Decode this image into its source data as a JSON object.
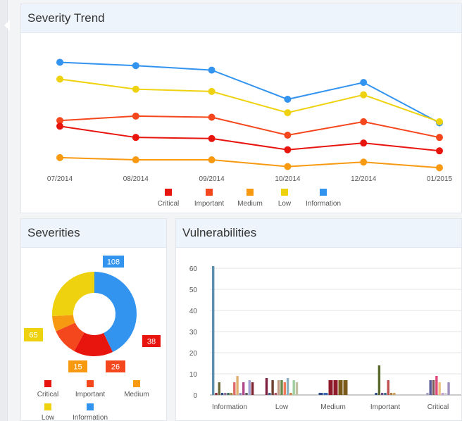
{
  "colors": {
    "critical": "#e8150f",
    "important": "#f5471d",
    "medium": "#f79a12",
    "low": "#efd20f",
    "information": "#3394f0"
  },
  "trend": {
    "title": "Severity Trend",
    "legend": [
      "Critical",
      "Important",
      "Medium",
      "Low",
      "Information"
    ],
    "chart_data": {
      "type": "line",
      "x": [
        "07/2014",
        "08/2014",
        "09/2014",
        "10/2014",
        "12/2014",
        "01/2015"
      ],
      "series": [
        {
          "name": "Information",
          "color": "#3394f0",
          "values": [
            108,
            105,
            101,
            75,
            90,
            54
          ]
        },
        {
          "name": "Low",
          "color": "#efd20f",
          "values": [
            93,
            84,
            82,
            63,
            79,
            55
          ]
        },
        {
          "name": "Important",
          "color": "#f5471d",
          "values": [
            56,
            60,
            59,
            43,
            55,
            41
          ]
        },
        {
          "name": "Critical",
          "color": "#e8150f",
          "values": [
            51,
            41,
            40,
            30,
            36,
            29
          ]
        },
        {
          "name": "Medium",
          "color": "#f79a12",
          "values": [
            23,
            21,
            21,
            15,
            19,
            14
          ]
        }
      ],
      "ylim": [
        0,
        115
      ],
      "legend_position": "bottom"
    }
  },
  "severities": {
    "title": "Severities",
    "legend": [
      "Critical",
      "Important",
      "Medium",
      "Low",
      "Information"
    ],
    "chart_data": {
      "type": "pie",
      "donut": true,
      "labels": [
        "Information",
        "Critical",
        "Important",
        "Medium",
        "Low"
      ],
      "values": [
        108,
        38,
        26,
        15,
        65
      ],
      "colors": [
        "#3394f0",
        "#e8150f",
        "#f5471d",
        "#f79a12",
        "#efd20f"
      ]
    }
  },
  "vulnerabilities": {
    "title": "Vulnerabilities",
    "chart_data": {
      "type": "bar",
      "categories": [
        "Information",
        "Low",
        "Medium",
        "Important",
        "Critical"
      ],
      "ylim": [
        0,
        60
      ],
      "yticks": [
        0,
        10,
        20,
        30,
        40,
        50,
        60
      ],
      "bars": [
        [
          61,
          1,
          6,
          1,
          1,
          1,
          1,
          6,
          9,
          1,
          6,
          1,
          7,
          6
        ],
        [
          8,
          1,
          7,
          1,
          7,
          7,
          6,
          8,
          1,
          7,
          6
        ],
        [
          1,
          1,
          7,
          7,
          7,
          7
        ],
        [
          1,
          14,
          1,
          1,
          7,
          1,
          1
        ],
        [
          1,
          7,
          7,
          9,
          6,
          1,
          1,
          6
        ]
      ],
      "bar_colors": [
        [
          "#5a8fb0",
          "#8f2b3a",
          "#6a6a3a",
          "#2a4a8a",
          "#8f6f9a",
          "#3a6a5a",
          "#9a8a3a",
          "#e06a6a",
          "#e0b070",
          "#8a8ac0",
          "#b04a8a",
          "#5a5a5a",
          "#a0a0d0",
          "#802030"
        ],
        [
          "#802040",
          "#3a5a8a",
          "#704030",
          "#b05060",
          "#c09a80",
          "#6a8a4a",
          "#f07a5a",
          "#8ab0c0",
          "#d08040",
          "#a0d0a0",
          "#c0c0a0"
        ],
        [
          "#2a4a8a",
          "#3a6ab0",
          "#8f1a2a",
          "#8f1a2a",
          "#7a5a1a",
          "#7a5a1a"
        ],
        [
          "#2a4a8a",
          "#5a6a2a",
          "#6a4a8a",
          "#3a6a8a",
          "#c05050",
          "#b08040",
          "#d0a060"
        ],
        [
          "#a0a0c0",
          "#5a5a9a",
          "#7a5a5a",
          "#e04a7a",
          "#f0c080",
          "#c0a0d0",
          "#d0d0d0",
          "#a090c0"
        ]
      ]
    }
  }
}
